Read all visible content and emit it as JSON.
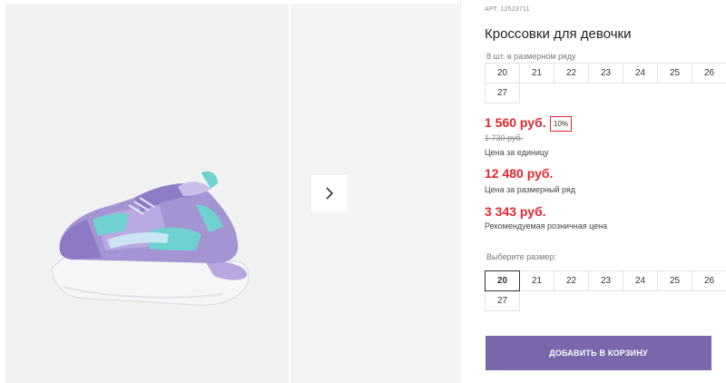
{
  "product": {
    "article_label": "АРТ.",
    "article_number": "12523711",
    "title": "Кроссовки для девочки",
    "pack_label": "8 шт. в размерном ряду",
    "pack_sizes": [
      "20",
      "21",
      "22",
      "23",
      "24",
      "25",
      "26",
      "27"
    ],
    "unit_price": "1 560 руб.",
    "discount": "10%",
    "old_price": "1 730 руб.",
    "unit_price_label": "Цена за единицу",
    "pack_price": "12 480 руб.",
    "pack_price_label": "Цена за размерный ряд",
    "retail_price": "3 343 руб.",
    "retail_price_label": "Рекомендуемая розничная цена",
    "choose_size_label": "Выберите размер:",
    "size_options": [
      "20",
      "21",
      "22",
      "23",
      "24",
      "25",
      "26",
      "27"
    ],
    "selected_size": "20",
    "add_to_cart": "ДОБАВИТЬ В КОРЗИНУ"
  },
  "gallery": {
    "next_icon": "chevron-right-icon"
  },
  "colors": {
    "price": "#e4262e",
    "button": "#7a66ab",
    "shoe_main": "#a594d3",
    "shoe_accent": "#6fd1cf"
  }
}
